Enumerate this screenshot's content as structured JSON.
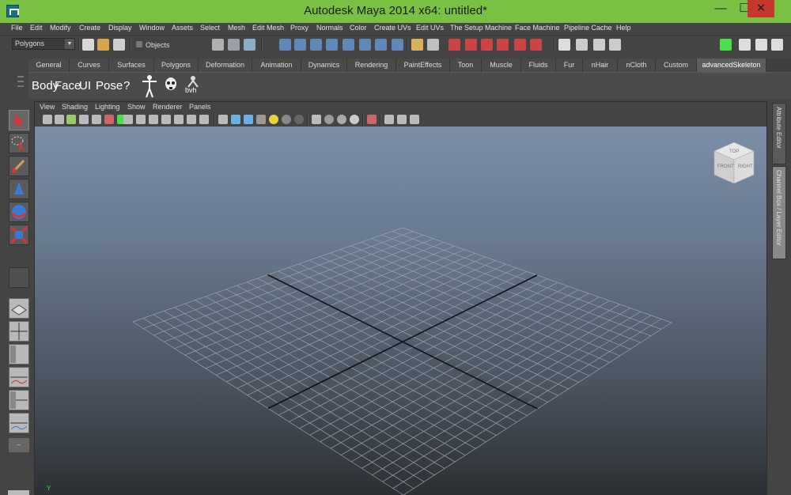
{
  "window": {
    "title": "Autodesk Maya 2014 x64: untitled*",
    "minimize": "—",
    "maximize": "☐",
    "close": "✕"
  },
  "menubar": [
    "File",
    "Edit",
    "Modify",
    "Create",
    "Display",
    "Window",
    "Assets",
    "Select",
    "Mesh",
    "Edit Mesh",
    "Proxy",
    "Normals",
    "Color",
    "Create UVs",
    "Edit UVs",
    "The Setup Machine",
    "Face Machine",
    "Pipeline Cache",
    "Help"
  ],
  "statusline": {
    "mode_value": "Polygons",
    "objects_label": "Objects"
  },
  "shelf": {
    "tabs": [
      "General",
      "Curves",
      "Surfaces",
      "Polygons",
      "Deformation",
      "Animation",
      "Dynamics",
      "Rendering",
      "PaintEffects",
      "Toon",
      "Muscle",
      "Fluids",
      "Fur",
      "nHair",
      "nCloth",
      "Custom",
      "advancedSkeleton"
    ],
    "active_tab": "advancedSkeleton",
    "items": [
      "Body",
      "Face",
      "UI",
      "Pose",
      "?"
    ],
    "bvh_label": "bvh"
  },
  "panel_menu": [
    "View",
    "Shading",
    "Lighting",
    "Show",
    "Renderer",
    "Panels"
  ],
  "viewcube": {
    "front": "FRONT",
    "right": "RIGHT",
    "top": "TOP"
  },
  "side_tabs": [
    "Attribute Editor",
    "Channel Box / Layer Editor"
  ],
  "axis_label": "Y",
  "colors": {
    "titlebar": "#7ac143",
    "close": "#c8372d",
    "ui_dark": "#444444"
  }
}
